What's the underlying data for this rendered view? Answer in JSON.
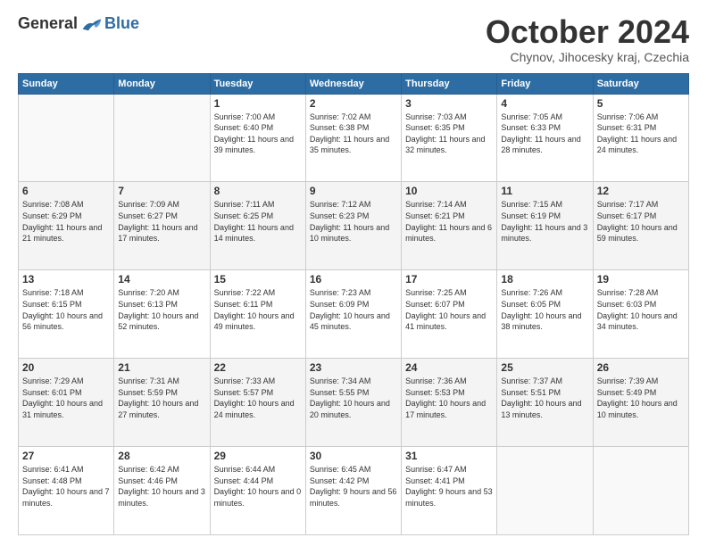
{
  "logo": {
    "general": "General",
    "blue": "Blue"
  },
  "header": {
    "month": "October 2024",
    "location": "Chynov, Jihocesky kraj, Czechia"
  },
  "days": [
    "Sunday",
    "Monday",
    "Tuesday",
    "Wednesday",
    "Thursday",
    "Friday",
    "Saturday"
  ],
  "weeks": [
    [
      {
        "day": "",
        "content": ""
      },
      {
        "day": "",
        "content": ""
      },
      {
        "day": "1",
        "content": "Sunrise: 7:00 AM\nSunset: 6:40 PM\nDaylight: 11 hours and 39 minutes."
      },
      {
        "day": "2",
        "content": "Sunrise: 7:02 AM\nSunset: 6:38 PM\nDaylight: 11 hours and 35 minutes."
      },
      {
        "day": "3",
        "content": "Sunrise: 7:03 AM\nSunset: 6:35 PM\nDaylight: 11 hours and 32 minutes."
      },
      {
        "day": "4",
        "content": "Sunrise: 7:05 AM\nSunset: 6:33 PM\nDaylight: 11 hours and 28 minutes."
      },
      {
        "day": "5",
        "content": "Sunrise: 7:06 AM\nSunset: 6:31 PM\nDaylight: 11 hours and 24 minutes."
      }
    ],
    [
      {
        "day": "6",
        "content": "Sunrise: 7:08 AM\nSunset: 6:29 PM\nDaylight: 11 hours and 21 minutes."
      },
      {
        "day": "7",
        "content": "Sunrise: 7:09 AM\nSunset: 6:27 PM\nDaylight: 11 hours and 17 minutes."
      },
      {
        "day": "8",
        "content": "Sunrise: 7:11 AM\nSunset: 6:25 PM\nDaylight: 11 hours and 14 minutes."
      },
      {
        "day": "9",
        "content": "Sunrise: 7:12 AM\nSunset: 6:23 PM\nDaylight: 11 hours and 10 minutes."
      },
      {
        "day": "10",
        "content": "Sunrise: 7:14 AM\nSunset: 6:21 PM\nDaylight: 11 hours and 6 minutes."
      },
      {
        "day": "11",
        "content": "Sunrise: 7:15 AM\nSunset: 6:19 PM\nDaylight: 11 hours and 3 minutes."
      },
      {
        "day": "12",
        "content": "Sunrise: 7:17 AM\nSunset: 6:17 PM\nDaylight: 10 hours and 59 minutes."
      }
    ],
    [
      {
        "day": "13",
        "content": "Sunrise: 7:18 AM\nSunset: 6:15 PM\nDaylight: 10 hours and 56 minutes."
      },
      {
        "day": "14",
        "content": "Sunrise: 7:20 AM\nSunset: 6:13 PM\nDaylight: 10 hours and 52 minutes."
      },
      {
        "day": "15",
        "content": "Sunrise: 7:22 AM\nSunset: 6:11 PM\nDaylight: 10 hours and 49 minutes."
      },
      {
        "day": "16",
        "content": "Sunrise: 7:23 AM\nSunset: 6:09 PM\nDaylight: 10 hours and 45 minutes."
      },
      {
        "day": "17",
        "content": "Sunrise: 7:25 AM\nSunset: 6:07 PM\nDaylight: 10 hours and 41 minutes."
      },
      {
        "day": "18",
        "content": "Sunrise: 7:26 AM\nSunset: 6:05 PM\nDaylight: 10 hours and 38 minutes."
      },
      {
        "day": "19",
        "content": "Sunrise: 7:28 AM\nSunset: 6:03 PM\nDaylight: 10 hours and 34 minutes."
      }
    ],
    [
      {
        "day": "20",
        "content": "Sunrise: 7:29 AM\nSunset: 6:01 PM\nDaylight: 10 hours and 31 minutes."
      },
      {
        "day": "21",
        "content": "Sunrise: 7:31 AM\nSunset: 5:59 PM\nDaylight: 10 hours and 27 minutes."
      },
      {
        "day": "22",
        "content": "Sunrise: 7:33 AM\nSunset: 5:57 PM\nDaylight: 10 hours and 24 minutes."
      },
      {
        "day": "23",
        "content": "Sunrise: 7:34 AM\nSunset: 5:55 PM\nDaylight: 10 hours and 20 minutes."
      },
      {
        "day": "24",
        "content": "Sunrise: 7:36 AM\nSunset: 5:53 PM\nDaylight: 10 hours and 17 minutes."
      },
      {
        "day": "25",
        "content": "Sunrise: 7:37 AM\nSunset: 5:51 PM\nDaylight: 10 hours and 13 minutes."
      },
      {
        "day": "26",
        "content": "Sunrise: 7:39 AM\nSunset: 5:49 PM\nDaylight: 10 hours and 10 minutes."
      }
    ],
    [
      {
        "day": "27",
        "content": "Sunrise: 6:41 AM\nSunset: 4:48 PM\nDaylight: 10 hours and 7 minutes."
      },
      {
        "day": "28",
        "content": "Sunrise: 6:42 AM\nSunset: 4:46 PM\nDaylight: 10 hours and 3 minutes."
      },
      {
        "day": "29",
        "content": "Sunrise: 6:44 AM\nSunset: 4:44 PM\nDaylight: 10 hours and 0 minutes."
      },
      {
        "day": "30",
        "content": "Sunrise: 6:45 AM\nSunset: 4:42 PM\nDaylight: 9 hours and 56 minutes."
      },
      {
        "day": "31",
        "content": "Sunrise: 6:47 AM\nSunset: 4:41 PM\nDaylight: 9 hours and 53 minutes."
      },
      {
        "day": "",
        "content": ""
      },
      {
        "day": "",
        "content": ""
      }
    ]
  ]
}
